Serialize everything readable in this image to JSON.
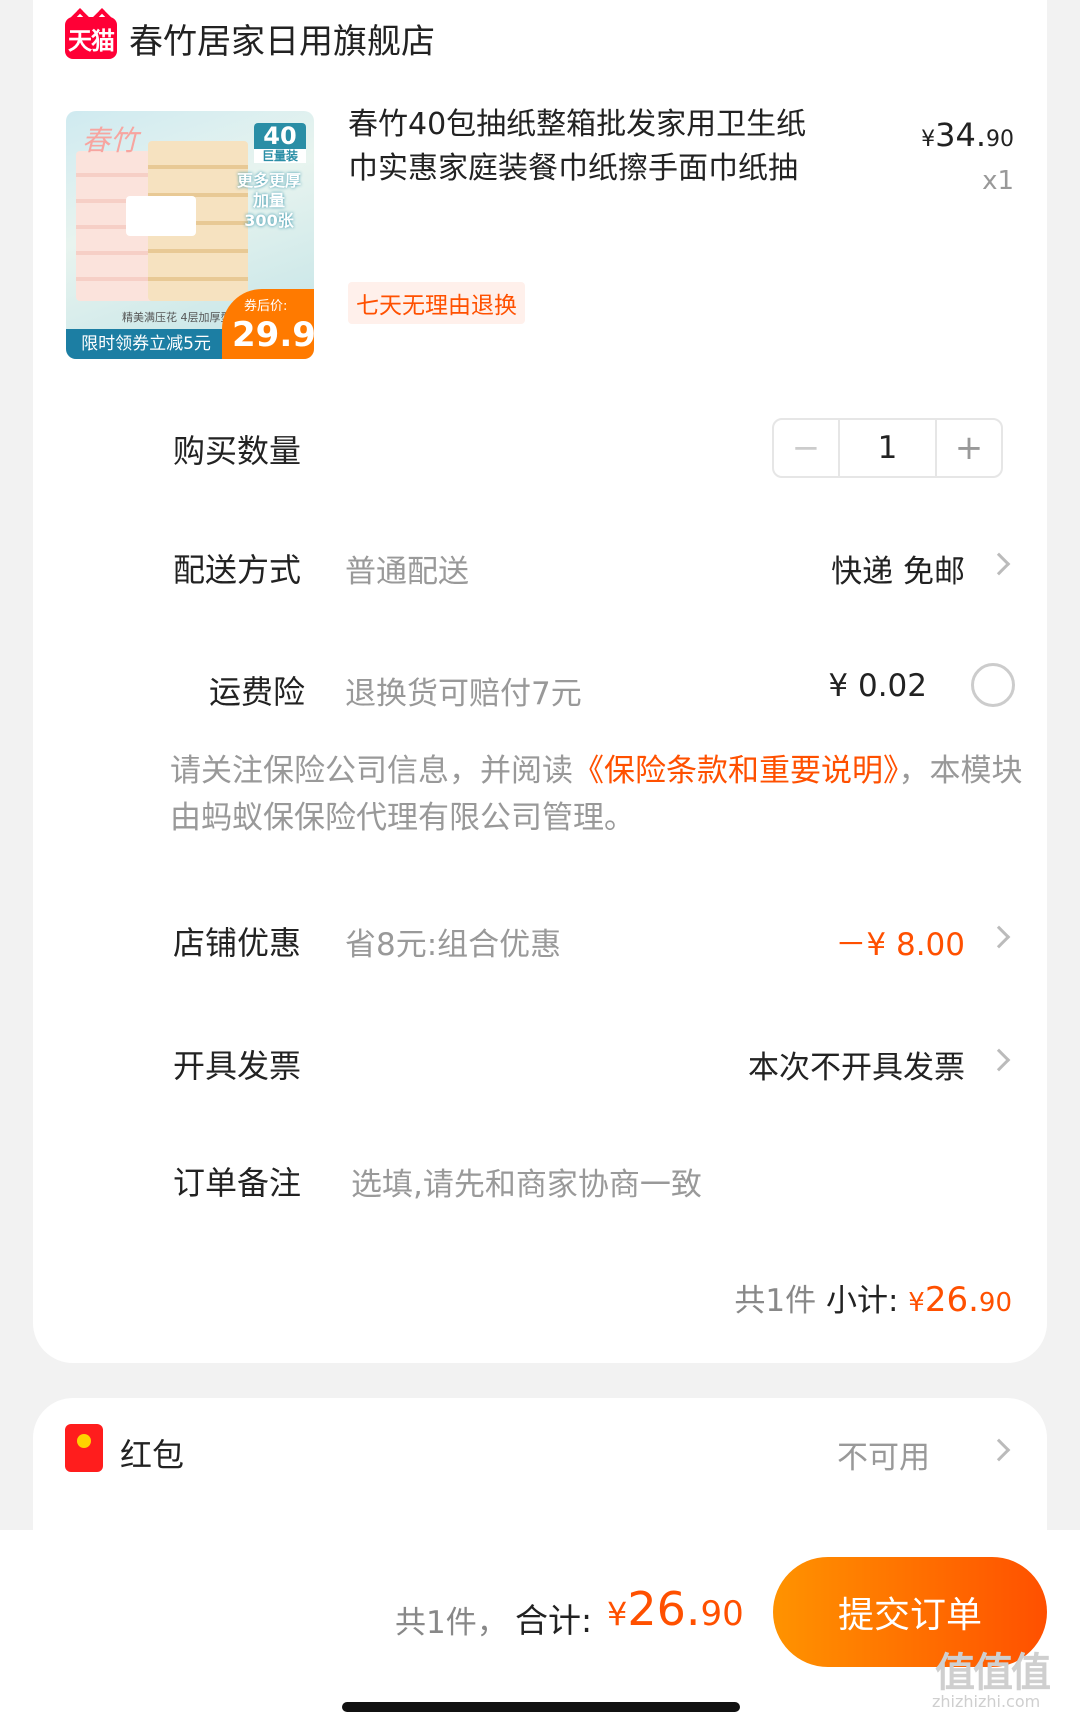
{
  "shop": {
    "logo_text": "天猫",
    "name": "春竹居家日用旗舰店"
  },
  "product": {
    "title": "春竹40包抽纸整箱批发家用卫生纸巾实惠家庭装餐巾纸擦手面巾纸抽",
    "price_symbol": "¥",
    "price_int": "34.",
    "price_dec": "90",
    "qty": "x1",
    "tag": "七天无理由退换",
    "image": {
      "brand": "春竹",
      "badge_num": "40",
      "badge_sub": "巨量装",
      "side_lines": [
        "更多更厚",
        "加量",
        "300张"
      ],
      "fine_print": "精美满压花  4层加厚型",
      "bottom_text": "限时领券立减5元",
      "price_label": "券后价:",
      "price_value": "29.9"
    }
  },
  "quantity": {
    "label": "购买数量",
    "minus": "−",
    "value": "1",
    "plus": "+"
  },
  "delivery": {
    "label": "配送方式",
    "sub": "普通配送",
    "value": "快递 免邮"
  },
  "insurance": {
    "label": "运费险",
    "sub": "退换货可赔付7元",
    "value": "¥ 0.02"
  },
  "notice": {
    "prefix": "请关注保险公司信息，并阅读",
    "link": "《保险条款和重要说明》",
    "suffix": "，本模块由蚂蚁保保险代理有限公司管理。"
  },
  "discount": {
    "label": "店铺优惠",
    "sub": "省8元:组合优惠",
    "value": "－¥ 8.00"
  },
  "invoice": {
    "label": "开具发票",
    "value": "本次不开具发票"
  },
  "remark": {
    "label": "订单备注",
    "placeholder": "选填,请先和商家协商一致"
  },
  "subtotal": {
    "count": "共1件",
    "label": "小计:",
    "symbol": "¥",
    "int": "26.",
    "dec": "90"
  },
  "red_packet": {
    "label": "红包",
    "value": "不可用"
  },
  "footer": {
    "count": "共1件，",
    "label": "合计:",
    "symbol": "¥",
    "int": "26.",
    "dec": "90",
    "submit": "提交订单",
    "watermark": "值值值",
    "watermark_sub": "zhizhizhi.com"
  },
  "colors": {
    "accent": "#ff5000",
    "tmall": "#ff0036"
  }
}
